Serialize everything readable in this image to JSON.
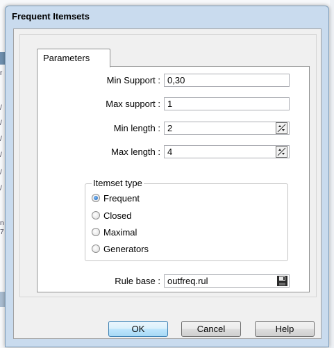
{
  "window": {
    "title": "Frequent Itemsets"
  },
  "tabs": [
    {
      "label": "Parameters",
      "active": true
    }
  ],
  "fields": {
    "min_support": {
      "label": "Min Support :",
      "value": "0,30"
    },
    "max_support": {
      "label": "Max support :",
      "value": "1"
    },
    "min_length": {
      "label": "Min length :",
      "value": "2"
    },
    "max_length": {
      "label": "Max length :",
      "value": "4"
    },
    "rule_base": {
      "label": "Rule base :",
      "value": "outfreq.rul"
    }
  },
  "itemset_type": {
    "legend": "Itemset type",
    "options": [
      {
        "label": "Frequent",
        "checked": true
      },
      {
        "label": "Closed",
        "checked": false
      },
      {
        "label": "Maximal",
        "checked": false
      },
      {
        "label": "Generators",
        "checked": false
      }
    ]
  },
  "buttons": {
    "ok": "OK",
    "cancel": "Cancel",
    "help": "Help"
  },
  "icons": {
    "spin": "spin-up-down-icon",
    "save": "floppy-disk-icon"
  },
  "colors": {
    "window_frame": "#c9dbee",
    "client_bg": "#f0f0f0",
    "default_button": "#bee6fd"
  }
}
